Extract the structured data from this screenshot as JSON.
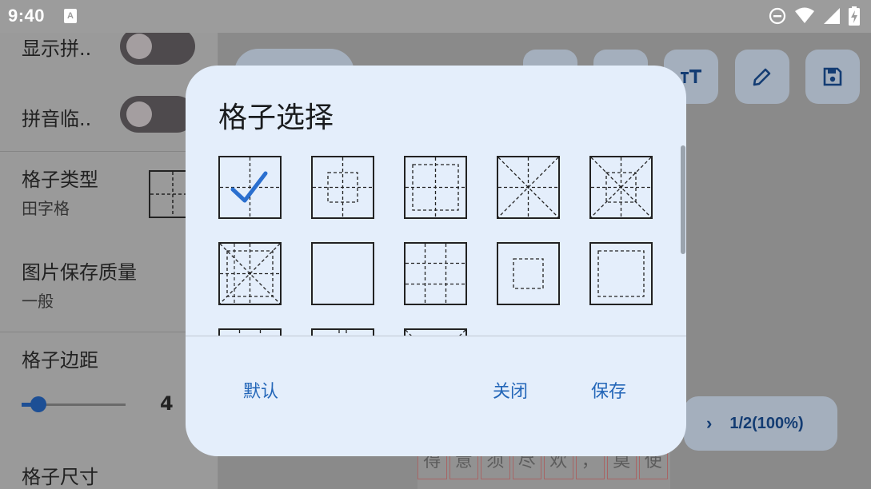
{
  "status_bar": {
    "time": "9:40",
    "notification_icon": "A",
    "icons": [
      "dnd-icon",
      "wifi-icon",
      "signal-icon",
      "battery-charging-icon"
    ]
  },
  "left_panel": {
    "show_pinyin_label": "显示拼..",
    "pinyin_trace_label": "拼音临..",
    "grid_type_label": "格子类型",
    "grid_type_value": "田字格",
    "image_quality_label": "图片保存质量",
    "image_quality_value": "一般",
    "grid_margin_label": "格子边距",
    "grid_margin_value": "4",
    "grid_margin_fraction": 0.1,
    "grid_size_label": "格子尺寸"
  },
  "toolbar": {
    "icons": [
      "font-size-icon",
      "edit-pencil-icon",
      "save-icon"
    ]
  },
  "page_indicator": {
    "label": "1/2(100%)"
  },
  "canvas_preview": {
    "chars": [
      "得",
      "意",
      "须",
      "尽",
      "欢",
      "，",
      "莫",
      "使"
    ]
  },
  "dialog": {
    "title": "格子选择",
    "selected_index": 0,
    "options": [
      "tianzi",
      "huigong",
      "huigong-tian",
      "mizi",
      "mizi-inner",
      "mizi-full",
      "plain",
      "jiugong",
      "center-box",
      "inner-box",
      "partial-1",
      "partial-2",
      "partial-3"
    ],
    "buttons": {
      "default": "默认",
      "close": "关闭",
      "save": "保存"
    }
  },
  "colors": {
    "accent": "#2366b8",
    "dialog_bg": "#e4eefb",
    "check": "#2a6fcf"
  }
}
